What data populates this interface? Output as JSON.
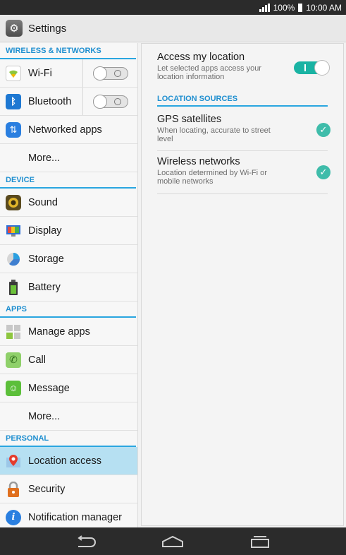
{
  "status": {
    "battery": "100%",
    "time": "10:00 AM"
  },
  "header": {
    "title": "Settings"
  },
  "sidebar": {
    "sections": [
      {
        "label": "WIRELESS & NETWORKS"
      },
      {
        "label": "DEVICE"
      },
      {
        "label": "APPS"
      },
      {
        "label": "PERSONAL"
      }
    ],
    "items": [
      {
        "label": "Wi-Fi",
        "icon": "wifi-icon",
        "toggle": "off"
      },
      {
        "label": "Bluetooth",
        "icon": "bluetooth-icon",
        "toggle": "off"
      },
      {
        "label": "Networked apps",
        "icon": "networked-apps-icon"
      },
      {
        "label": "More..."
      },
      {
        "label": "Sound",
        "icon": "speaker-icon"
      },
      {
        "label": "Display",
        "icon": "monitor-icon"
      },
      {
        "label": "Storage",
        "icon": "pie-chart-icon"
      },
      {
        "label": "Battery",
        "icon": "battery-icon"
      },
      {
        "label": "Manage apps",
        "icon": "grid-icon"
      },
      {
        "label": "Call",
        "icon": "phone-icon"
      },
      {
        "label": "Message",
        "icon": "message-icon"
      },
      {
        "label": "More..."
      },
      {
        "label": "Location access",
        "icon": "location-pin-icon",
        "selected": true
      },
      {
        "label": "Security",
        "icon": "lock-icon"
      },
      {
        "label": "Notification manager",
        "icon": "info-icon"
      }
    ]
  },
  "detail": {
    "access": {
      "title": "Access my location",
      "subtitle": "Let selected apps access your location information",
      "enabled": true
    },
    "section": "LOCATION SOURCES",
    "sources": [
      {
        "title": "GPS satellites",
        "subtitle": "When locating, accurate to street level",
        "checked": true
      },
      {
        "title": "Wireless networks",
        "subtitle": "Location determined by Wi-Fi or mobile networks",
        "checked": true
      }
    ]
  },
  "colors": {
    "accent": "#2aa6e0",
    "toggle_on": "#19b3a3",
    "selected": "#b6e0f2"
  }
}
